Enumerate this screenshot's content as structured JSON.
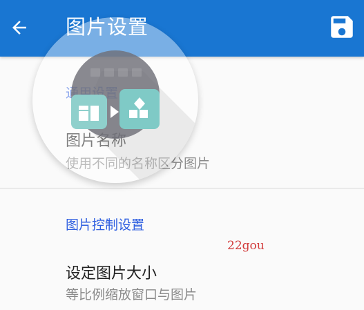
{
  "toolbar": {
    "title": "图片设置",
    "back_icon": "arrow-back-icon",
    "save_icon": "floppy-save-icon",
    "background_color": "#1976d2"
  },
  "sections": [
    {
      "header": "通用设置",
      "items": [
        {
          "title": "图片名称",
          "summary": "使用不同的名称区分图片"
        }
      ]
    },
    {
      "header": "图片控制设置",
      "items": [
        {
          "title": "设定图片大小",
          "summary": "等比例缩放窗口与图片"
        }
      ]
    }
  ],
  "overlay": {
    "icon": "app-shortcut-icon"
  },
  "watermark": "22gou"
}
